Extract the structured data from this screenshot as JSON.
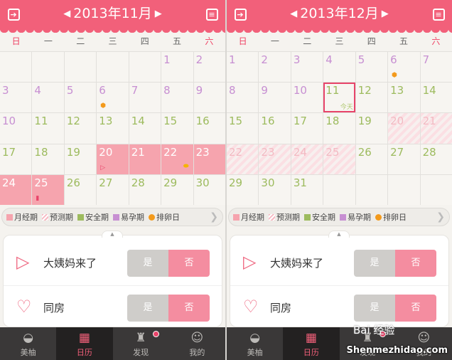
{
  "weekdays": [
    "日",
    "一",
    "二",
    "三",
    "四",
    "五",
    "六"
  ],
  "left": {
    "month": "2013年11月",
    "cells": [
      {
        "day": ""
      },
      {
        "day": ""
      },
      {
        "day": ""
      },
      {
        "day": ""
      },
      {
        "day": ""
      },
      {
        "day": "1",
        "color": "purple"
      },
      {
        "day": "2",
        "color": "purple"
      },
      {
        "day": "3",
        "color": "purple"
      },
      {
        "day": "4",
        "color": "purple"
      },
      {
        "day": "5",
        "color": "purple"
      },
      {
        "day": "6",
        "color": "purple",
        "mark": "ovulation"
      },
      {
        "day": "7",
        "color": "purple"
      },
      {
        "day": "8",
        "color": "purple"
      },
      {
        "day": "9",
        "color": "purple"
      },
      {
        "day": "10",
        "color": "purple"
      },
      {
        "day": "11",
        "color": "green"
      },
      {
        "day": "12",
        "color": "green"
      },
      {
        "day": "13",
        "color": "green"
      },
      {
        "day": "14",
        "color": "green"
      },
      {
        "day": "15",
        "color": "green"
      },
      {
        "day": "16",
        "color": "green"
      },
      {
        "day": "17",
        "color": "green"
      },
      {
        "day": "18",
        "color": "green"
      },
      {
        "day": "19",
        "color": "green"
      },
      {
        "day": "20",
        "state": "period",
        "mark": "flag"
      },
      {
        "day": "21",
        "state": "period"
      },
      {
        "day": "22",
        "state": "period",
        "mark": "egg"
      },
      {
        "day": "23",
        "state": "period"
      },
      {
        "day": "24",
        "state": "period"
      },
      {
        "day": "25",
        "state": "period",
        "mark": "pad"
      },
      {
        "day": "26",
        "color": "green"
      },
      {
        "day": "27",
        "color": "green"
      },
      {
        "day": "28",
        "color": "green"
      },
      {
        "day": "29",
        "color": "green"
      },
      {
        "day": "30",
        "color": "green"
      }
    ]
  },
  "right": {
    "month": "2013年12月",
    "today_label": "今天",
    "cells": [
      {
        "day": "1",
        "color": "purple"
      },
      {
        "day": "2",
        "color": "purple"
      },
      {
        "day": "3",
        "color": "purple"
      },
      {
        "day": "4",
        "color": "purple"
      },
      {
        "day": "5",
        "color": "purple"
      },
      {
        "day": "6",
        "color": "purple",
        "mark": "ovulation"
      },
      {
        "day": "7",
        "color": "purple"
      },
      {
        "day": "8",
        "color": "purple"
      },
      {
        "day": "9",
        "color": "purple"
      },
      {
        "day": "10",
        "color": "purple"
      },
      {
        "day": "11",
        "color": "green",
        "today": true
      },
      {
        "day": "12",
        "color": "green"
      },
      {
        "day": "13",
        "color": "green"
      },
      {
        "day": "14",
        "color": "green"
      },
      {
        "day": "15",
        "color": "green"
      },
      {
        "day": "16",
        "color": "green"
      },
      {
        "day": "17",
        "color": "green"
      },
      {
        "day": "18",
        "color": "green"
      },
      {
        "day": "19",
        "color": "green"
      },
      {
        "day": "20",
        "state": "predict"
      },
      {
        "day": "21",
        "state": "predict"
      },
      {
        "day": "22",
        "state": "predict"
      },
      {
        "day": "23",
        "state": "predict"
      },
      {
        "day": "24",
        "state": "predict"
      },
      {
        "day": "25",
        "state": "predict"
      },
      {
        "day": "26",
        "color": "green"
      },
      {
        "day": "27",
        "color": "green"
      },
      {
        "day": "28",
        "color": "green"
      },
      {
        "day": "29",
        "color": "green"
      },
      {
        "day": "30",
        "color": "green"
      },
      {
        "day": "31",
        "color": "green"
      },
      {
        "day": ""
      },
      {
        "day": ""
      },
      {
        "day": ""
      },
      {
        "day": ""
      }
    ]
  },
  "legend": {
    "period": "月经期",
    "predicted": "预测期",
    "safe": "安全期",
    "fertile": "易孕期",
    "ovulation": "排卵日"
  },
  "rows": {
    "period_came": "大姨妈来了",
    "intimacy": "同房"
  },
  "toggle": {
    "yes": "是",
    "no": "否"
  },
  "tabs": {
    "meiyou": "美柚",
    "calendar": "日历",
    "discover": "发现",
    "mine": "我的"
  },
  "watermark": {
    "baidu": "Bai 经验",
    "site": "Shenmezhidao.com"
  },
  "colors": {
    "header": "#f2607a",
    "period": "#f6a4ae",
    "safe": "#9dbb5e",
    "fertile": "#c78fd2",
    "ovulation": "#f39a1c",
    "today_border": "#e8446a"
  },
  "icons": {
    "header_left": "back-arrow-box-icon",
    "header_right": "clipboard-icon",
    "row1": "play-triangle-icon",
    "row2": "heart-outline-icon"
  }
}
